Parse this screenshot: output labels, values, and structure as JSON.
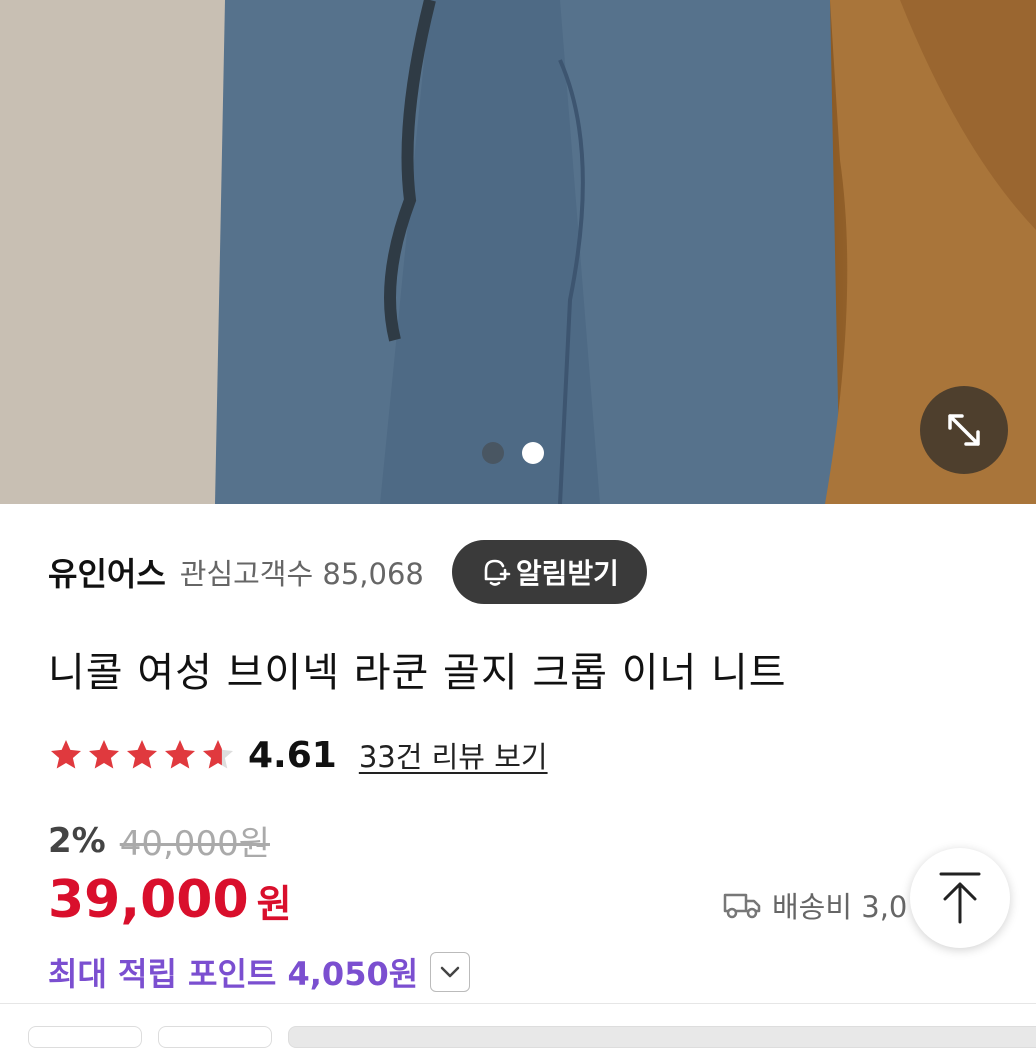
{
  "product_image": {
    "slide_current": 2,
    "slide_count": 2
  },
  "store": {
    "name": "유인어스",
    "followers_text": "관심고객수 85,068",
    "notify_label": "알림받기"
  },
  "product": {
    "title": "니콜 여성 브이넥 라쿤 골지 크롭 이너 니트",
    "rating": "4.61",
    "rating_value": 4.61,
    "rating_max": 5,
    "review_link": "33건 리뷰 보기",
    "discount": "2%",
    "original_price": "40,000원",
    "price": "39,000",
    "price_unit": "원",
    "shipping": "배송비 3,0",
    "max_points": "최대 적립 포인트 4,050원"
  },
  "colors": {
    "price": "#d90f2c",
    "star": "#e0393e",
    "points": "#7b4fd0",
    "notify_bg": "#3a3a3a"
  },
  "icons": {
    "expand": "expand-icon",
    "bell": "bell-plus-icon",
    "truck": "truck-icon",
    "scroll_top": "arrow-up-icon",
    "chevron": "chevron-down-icon"
  }
}
